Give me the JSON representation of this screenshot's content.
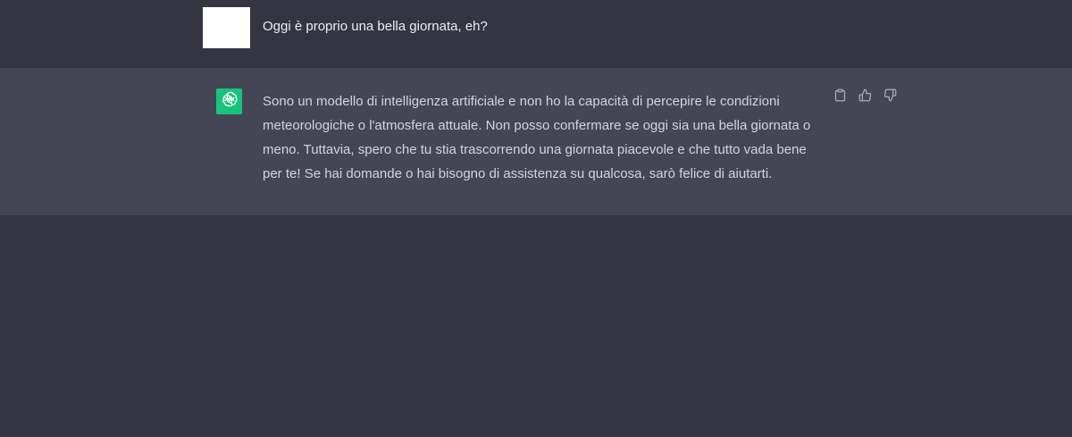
{
  "conversation": {
    "user_message": "Oggi è proprio una bella giornata, eh?",
    "assistant_lines": [
      "Sono un modello di intelligenza artificiale e non ho la capacità di percepire le condizioni",
      "meteorologiche o l'atmosfera attuale. Non posso confermare se oggi sia una bella giornata o",
      "meno. Tuttavia, spero che tu stia trascorrendo una giornata piacevole e che tutto vada bene",
      "per te! Se hai domande o hai bisogno di assistenza su qualcosa, sarò felice di aiutarti."
    ]
  },
  "actions": [
    {
      "icon": "clipboard-icon"
    },
    {
      "icon": "thumbs-up-icon"
    },
    {
      "icon": "thumbs-down-icon"
    }
  ],
  "colors": {
    "background": "#343541",
    "assistant_row": "#444654",
    "bot_avatar": "#19c37d",
    "user_avatar": "#ffffff",
    "text": "#d1d5db"
  }
}
